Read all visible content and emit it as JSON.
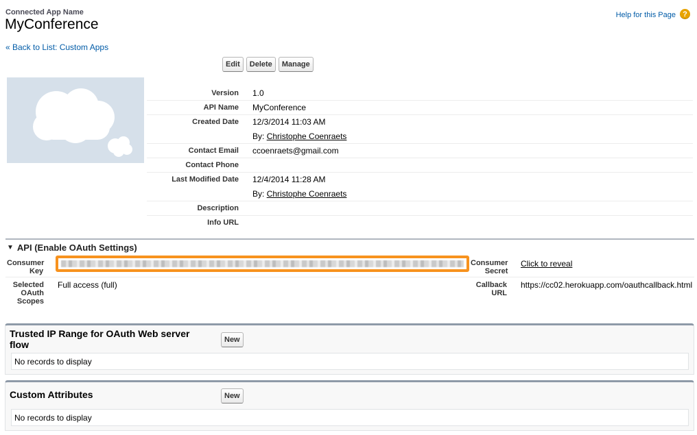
{
  "header": {
    "eyebrow": "Connected App Name",
    "title": "MyConference",
    "help_label": "Help for this Page",
    "help_icon": "question-icon"
  },
  "back_link": "« Back to List: Custom Apps",
  "buttons": {
    "edit": "Edit",
    "delete": "Delete",
    "manage": "Manage"
  },
  "detail": {
    "version": {
      "label": "Version",
      "value": "1.0"
    },
    "api_name": {
      "label": "API Name",
      "value": "MyConference"
    },
    "created_date": {
      "label": "Created Date",
      "value": "12/3/2014 11:03 AM",
      "by_prefix": "By:",
      "by_user": "Christophe Coenraets"
    },
    "contact_email": {
      "label": "Contact Email",
      "value": "ccoenraets@gmail.com"
    },
    "contact_phone": {
      "label": "Contact Phone",
      "value": ""
    },
    "last_modified": {
      "label": "Last Modified Date",
      "value": "12/4/2014 11:28 AM",
      "by_prefix": "By:",
      "by_user": "Christophe Coenraets"
    },
    "description": {
      "label": "Description",
      "value": ""
    },
    "info_url": {
      "label": "Info URL",
      "value": ""
    }
  },
  "api_section": {
    "title": "API (Enable OAuth Settings)",
    "consumer_key_label_1": "Consumer",
    "consumer_key_label_2": "Key",
    "consumer_secret_label_1": "Consumer",
    "consumer_secret_label_2": "Secret",
    "reveal_link": "Click to reveal",
    "scopes_label_1": "Selected",
    "scopes_label_2": "OAuth",
    "scopes_label_3": "Scopes",
    "scopes_value": "Full access (full)",
    "callback_label_1": "Callback",
    "callback_label_2": "URL",
    "callback_value": "https://cc02.herokuapp.com/oauthcallback.html",
    "highlight_color": "#f7921e"
  },
  "trusted_ip": {
    "title_line1": "Trusted IP Range for OAuth Web server",
    "title_line2": "flow",
    "new_button": "New",
    "empty_text": "No records to display"
  },
  "custom_attributes": {
    "title": "Custom Attributes",
    "new_button": "New",
    "empty_text": "No records to display"
  },
  "colors": {
    "link": "#015ba7",
    "section_border": "#8e9aa8"
  }
}
